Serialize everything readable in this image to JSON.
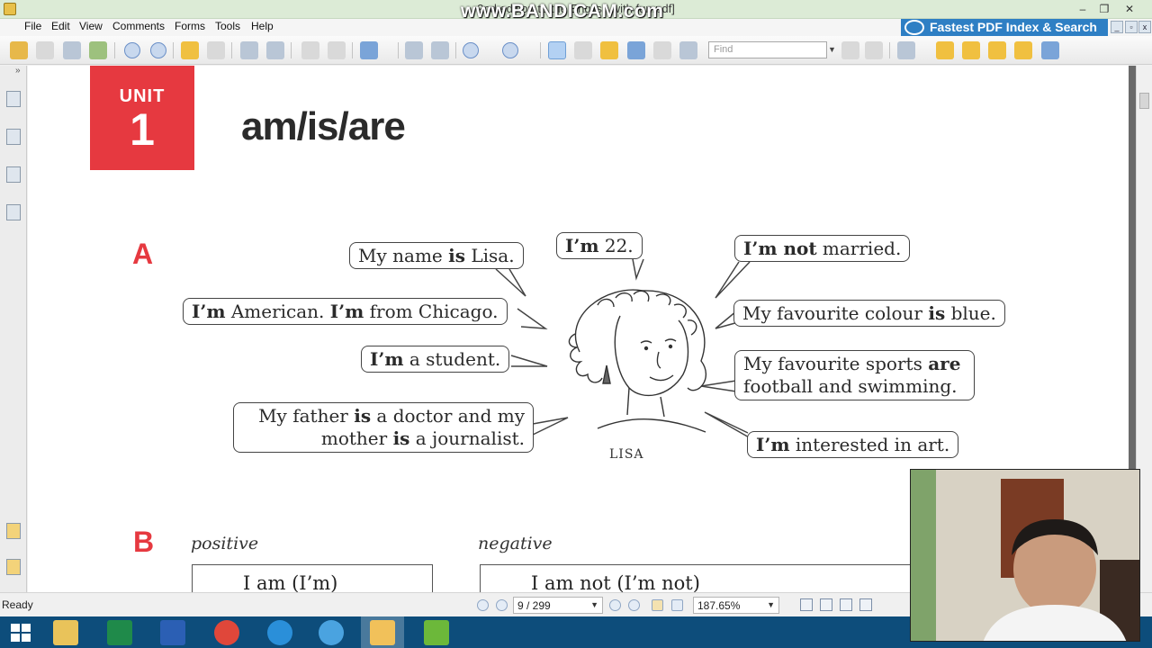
{
  "window": {
    "title": "2nd edition to the English with fun.pdf]",
    "watermark": "www.BANDICAM.com",
    "controls": [
      "–",
      "❐",
      "✕"
    ]
  },
  "menu": {
    "items": [
      "File",
      "Edit",
      "View",
      "Comments",
      "Forms",
      "Tools",
      "Help"
    ],
    "ad_banner": "Fastest PDF Index & Search"
  },
  "toolbar": {
    "find_placeholder": "Find"
  },
  "document": {
    "unit_label": "UNIT",
    "unit_number": "1",
    "unit_title": "am/is/are",
    "section_a": "A",
    "section_b": "B",
    "character_name": "LISA",
    "bubbles": {
      "name": [
        "My name ",
        "is",
        " Lisa."
      ],
      "age": [
        "I’m",
        " 22."
      ],
      "married": [
        "I’m not",
        " married."
      ],
      "american": [
        "I’m",
        " American. ",
        "I’m",
        " from Chicago."
      ],
      "colour": [
        "My favourite colour ",
        "is",
        " blue."
      ],
      "student": [
        "I’m",
        " a student."
      ],
      "sports": [
        "My favourite sports ",
        "are",
        " football and swimming."
      ],
      "father": [
        "My father ",
        "is",
        " a doctor and my mother ",
        "is",
        " a journalist."
      ],
      "art": [
        "I’m",
        " interested in art."
      ]
    },
    "positive_label": "positive",
    "negative_label": "negative",
    "positive_row": "I   am  (I’m)",
    "negative_row": "I   am  not    (I’m not)"
  },
  "statusbar": {
    "status": "Ready",
    "page": "9 / 299",
    "zoom": "187.65%"
  },
  "taskbar": {
    "apps": [
      "start-button",
      "file-explorer",
      "excel",
      "word",
      "chrome",
      "internet-explorer",
      "settings",
      "pdf-editor",
      "utorrent"
    ]
  }
}
